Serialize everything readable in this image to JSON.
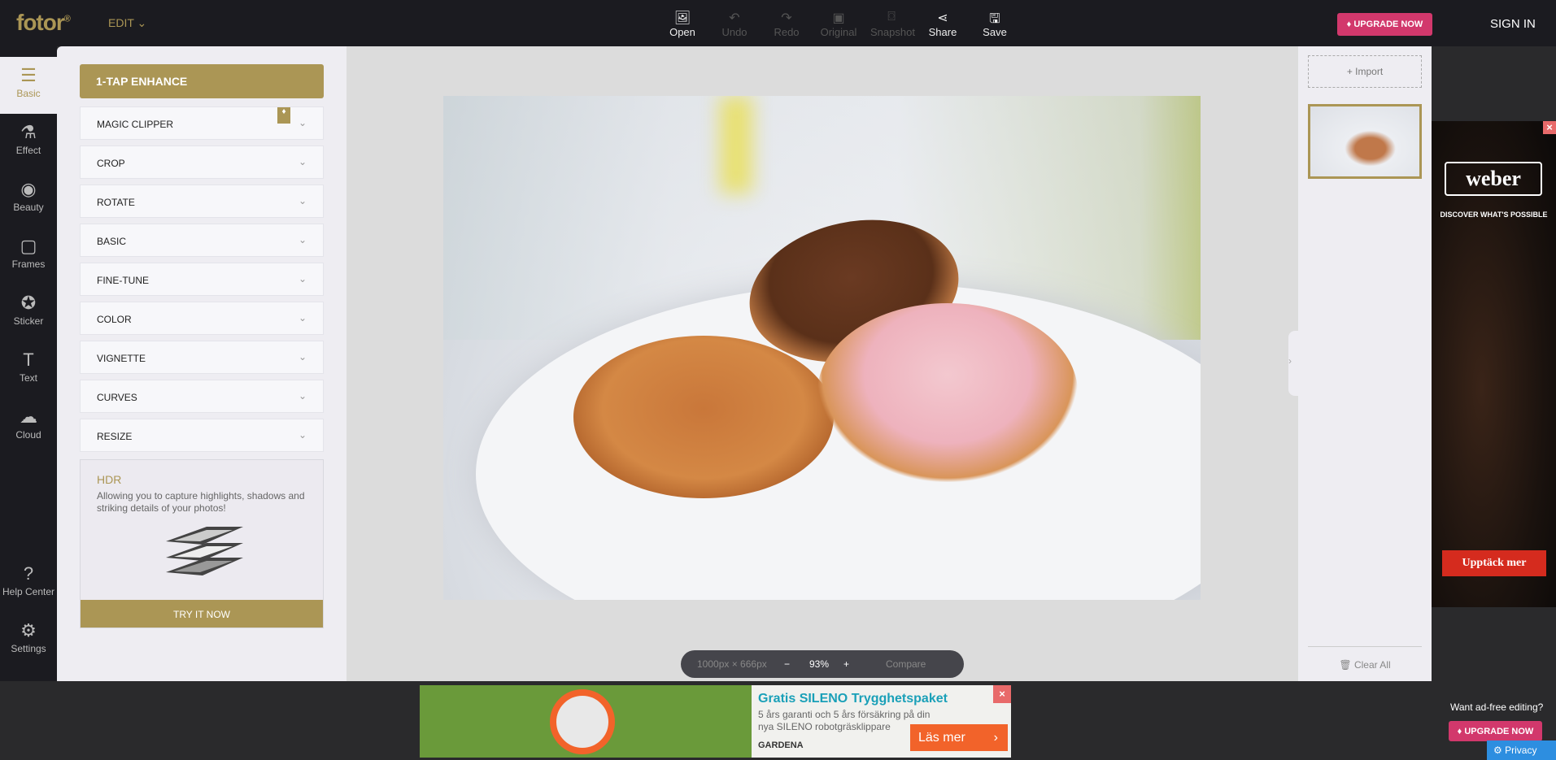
{
  "header": {
    "logo": "fotor",
    "logo_mark": "®",
    "mode": "EDIT",
    "tools": [
      {
        "label": "Open",
        "icon": "open-image-icon",
        "enabled": true
      },
      {
        "label": "Undo",
        "icon": "undo-icon",
        "enabled": false
      },
      {
        "label": "Redo",
        "icon": "redo-icon",
        "enabled": false
      },
      {
        "label": "Original",
        "icon": "original-icon",
        "enabled": false
      },
      {
        "label": "Snapshot",
        "icon": "snapshot-icon",
        "enabled": false
      },
      {
        "label": "Share",
        "icon": "share-icon",
        "enabled": true
      },
      {
        "label": "Save",
        "icon": "save-icon",
        "enabled": true
      }
    ],
    "upgrade": "UPGRADE NOW",
    "signin": "SIGN IN"
  },
  "rail": {
    "items": [
      {
        "label": "Basic",
        "icon": "sliders-icon"
      },
      {
        "label": "Effect",
        "icon": "flask-icon"
      },
      {
        "label": "Beauty",
        "icon": "eye-icon"
      },
      {
        "label": "Frames",
        "icon": "frame-icon"
      },
      {
        "label": "Sticker",
        "icon": "star-icon"
      },
      {
        "label": "Text",
        "icon": "text-icon"
      },
      {
        "label": "Cloud",
        "icon": "cloud-upload-icon"
      }
    ],
    "help": "Help Center",
    "settings": "Settings"
  },
  "panel": {
    "enhance": "1-TAP ENHANCE",
    "sections": [
      "MAGIC CLIPPER",
      "CROP",
      "ROTATE",
      "BASIC",
      "FINE-TUNE",
      "COLOR",
      "VIGNETTE",
      "CURVES",
      "RESIZE"
    ],
    "hdr": {
      "title": "HDR",
      "text": "Allowing you to capture highlights, shadows and striking details of your photos!",
      "cta": "TRY IT NOW"
    }
  },
  "canvas": {
    "dimensions": "1000px × 666px",
    "zoom": "93%",
    "compare": "Compare"
  },
  "right": {
    "import": "Import",
    "clear": "Clear All"
  },
  "ads": {
    "weber": {
      "brand": "weber",
      "tagline": "DISCOVER WHAT'S POSSIBLE",
      "cta": "Upptäck mer"
    },
    "banner": {
      "title": "Gratis SILENO Trygghetspaket",
      "text": "5 års garanti och 5 års försäkring på din nya SILENO robotgräsklippare",
      "cta": "Läs mer",
      "brand": "GARDENA"
    },
    "want": "Want ad-free editing?",
    "upgrade": "UPGRADE NOW",
    "privacy": "Privacy"
  },
  "colors": {
    "accent": "#ab9655",
    "upgrade": "#d2386c",
    "topbar": "#1b1b20"
  }
}
